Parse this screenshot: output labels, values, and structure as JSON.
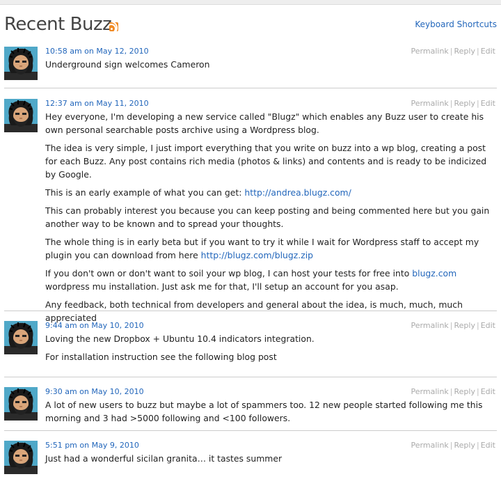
{
  "header": {
    "title": "Recent Buzz",
    "shortcuts": "Keyboard Shortcuts"
  },
  "actions": {
    "permalink": "Permalink",
    "reply": "Reply",
    "edit": "Edit"
  },
  "posts": [
    {
      "timestamp": "10:58 am on May 12, 2010",
      "paragraphs": [
        "Underground sign welcomes Cameron"
      ]
    },
    {
      "timestamp": "12:37 am on May 11, 2010",
      "paragraphs": [
        "Hey everyone, I'm developing a new service called \"Blugz\" which enables any Buzz user to create his own personal searchable posts archive using a Wordpress blog.",
        "The idea is very simple, I just import everything that you write on buzz into a wp blog, creating a post for each Buzz. Any post contains rich media (photos & links) and contents and is ready to be indicized by Google.",
        "This is an early example of what you can get:",
        "This can probably interest you because you can keep posting and being commented here but you gain another way to be known and to spread your thoughts.",
        "The whole thing is in early beta but if you want to try it while I wait for Wordpress staff to accept my plugin you can download from here",
        "If you don't own or don't want to soil your wp blog, I can host your tests for free into",
        "wordpress mu installation. Just ask me for that, I'll setup an account for you asap.",
        "Any feedback, both technical from developers and general about the idea, is much, much, much appreciated"
      ],
      "links": {
        "example": "http://andrea.blugz.com/",
        "download": "http://blugz.com/blugz.zip",
        "host": "blugz.com"
      }
    },
    {
      "timestamp": "9:44 am on May 10, 2010",
      "paragraphs": [
        "Loving the new Dropbox + Ubuntu 10.4 indicators integration.",
        "For installation instruction see the following blog post"
      ]
    },
    {
      "timestamp": "9:30 am on May 10, 2010",
      "paragraphs": [
        "A lot of new users to buzz but maybe a lot of spammers too. 12 new people started following me this morning and 3 had >5000 following and <100 followers."
      ]
    },
    {
      "timestamp": "5:51 pm on May 9, 2010",
      "paragraphs": [
        "Just had a wonderful sicilan granita… it tastes summer"
      ]
    }
  ]
}
